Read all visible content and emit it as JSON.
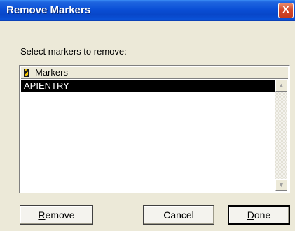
{
  "window": {
    "title": "Remove Markers",
    "close_label": "X"
  },
  "prompt": "Select markers to remove:",
  "list": {
    "header": "Markers",
    "header_icon": "marker-stripes-icon",
    "items": [
      "APIENTRY"
    ],
    "selected_index": 0
  },
  "scrollbar": {
    "up_icon": "▲",
    "down_icon": "▼"
  },
  "buttons": {
    "remove": {
      "access_key": "R",
      "rest": "emove"
    },
    "cancel": "Cancel",
    "done": {
      "access_key": "D",
      "rest": "one"
    }
  }
}
